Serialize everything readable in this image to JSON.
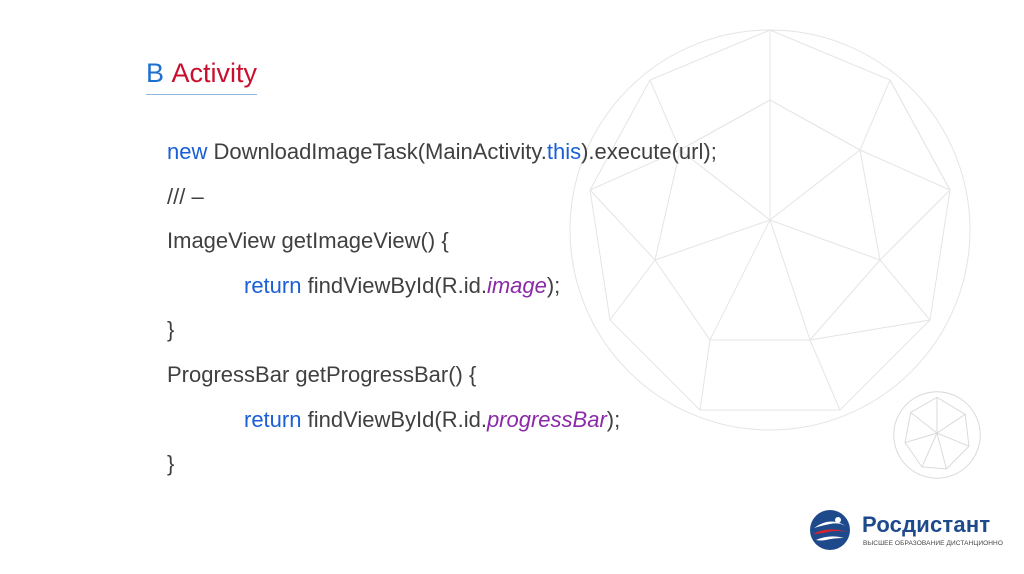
{
  "title": {
    "prefix": "В",
    "text": "Activity"
  },
  "code": {
    "line1": {
      "kw": "new",
      "mid": " DownloadImageTask(MainActivity.",
      "kw2": "this",
      "end": ").execute(url);"
    },
    "line2": {
      "text": "/// –"
    },
    "line3": {
      "text": "ImageView getImageView() {"
    },
    "line4": {
      "kw": "return",
      "mid": " findViewById(R.id.",
      "ital": "image",
      "end": ");"
    },
    "line5": {
      "text": "}"
    },
    "line6": {
      "text": "ProgressBar getProgressBar() {"
    },
    "line7": {
      "kw": "return",
      "mid": " findViewById(R.id.",
      "ital": "progressBar",
      "end": ");"
    },
    "line8": {
      "text": "}"
    }
  },
  "logo": {
    "name": "Росдистант",
    "tagline": "ВЫСШЕЕ ОБРАЗОВАНИЕ ДИСТАНЦИОННО"
  },
  "colors": {
    "title": "#c8102e",
    "title_prefix": "#1f6fd0",
    "keyword": "#1a5fd6",
    "italic_field": "#8a2aa8",
    "code_text": "#404040",
    "logo_blue": "#1e4a8c",
    "logo_red": "#d3262f"
  }
}
